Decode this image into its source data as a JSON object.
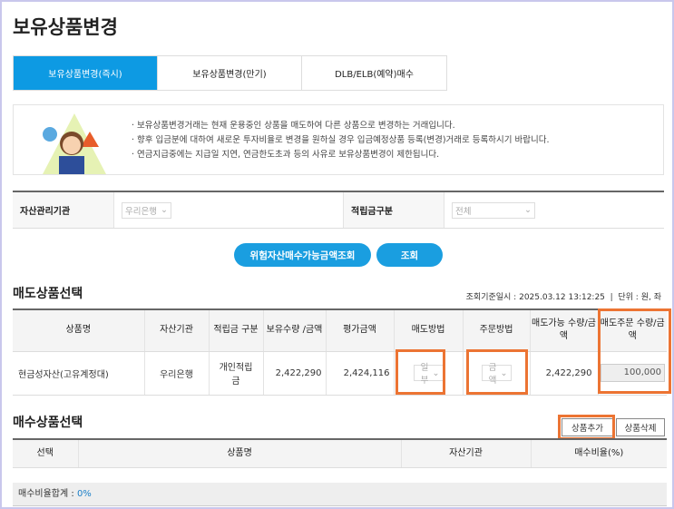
{
  "page": {
    "title": "보유상품변경"
  },
  "tabs": [
    {
      "label": "보유상품변경(즉시)"
    },
    {
      "label": "보유상품변경(만기)"
    },
    {
      "label": "DLB/ELB(예약)매수"
    }
  ],
  "notice": [
    "보유상품변경거래는 현재 운용중인 상품을 매도하여 다른 상품으로 변경하는 거래입니다.",
    "향후 입금분에 대하여 새로운 투자비율로 변경을 원하실 경우 입금예정상품 등록(변경)거래로 등록하시기 바랍니다.",
    "연금지급중에는 지급일 지연, 연금한도초과 등의 사유로 보유상품변경이 제한됩니다."
  ],
  "filter": {
    "institution_label": "자산관리기관",
    "institution_value": "우리은행",
    "type_label": "적립금구분",
    "type_value": "전체"
  },
  "buttons": {
    "risk_query": "위험자산매수가능금액조회",
    "query": "조회",
    "add": "상품추가",
    "delete": "상품삭제"
  },
  "sell": {
    "title": "매도상품선택",
    "query_time_label": "조회기준일시 :",
    "query_time": "2025.03.12 13:12:25",
    "unit": "단위 : 원, 좌",
    "headers": [
      "상품명",
      "자산기관",
      "적립금 구분",
      "보유수량 /금액",
      "평가금액",
      "매도방법",
      "주문방법",
      "매도가능 수량/금액",
      "매도주문 수량/금액"
    ],
    "row": {
      "name": "현금성자산(고유계정대)",
      "institution": "우리은행",
      "type": "개인적립금",
      "holding": "2,422,290",
      "valuation": "2,424,116",
      "method": "일부",
      "order": "금액",
      "available": "2,422,290",
      "order_amount": "100,000"
    }
  },
  "buy": {
    "title": "매수상품선택",
    "headers": [
      "선택",
      "상품명",
      "자산기관",
      "매수비율(%)"
    ],
    "total_label": "매수비율합계 :",
    "total_value": "0%"
  },
  "colors": {
    "accent": "#1a9ee0",
    "highlight": "#ec7433"
  }
}
